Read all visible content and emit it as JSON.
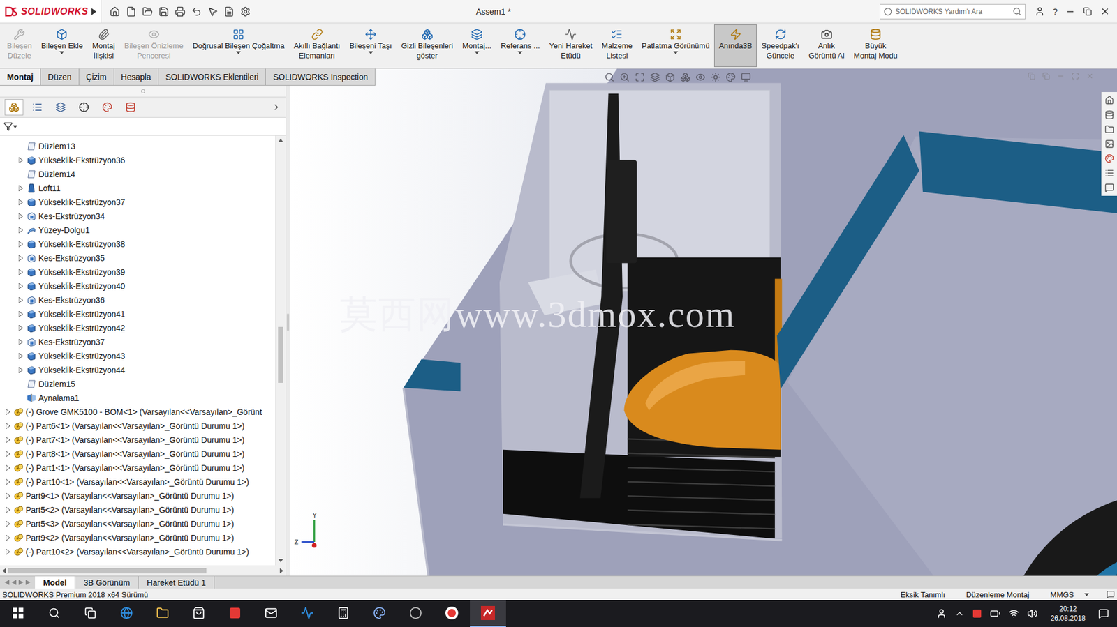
{
  "window": {
    "logo": "SOLIDWORKS",
    "title": "Assem1 *",
    "search_placeholder": "SOLIDWORKS Yardım'ı Ara",
    "help": "?"
  },
  "ribbon": [
    {
      "lines": [
        "Bileşen",
        "Düzele"
      ],
      "disabled": true,
      "pressed": false,
      "dropdown": false
    },
    {
      "lines": [
        "Bileşen Ekle"
      ],
      "disabled": false,
      "pressed": false,
      "dropdown": true
    },
    {
      "lines": [
        "Montaj",
        "İlişkisi"
      ],
      "disabled": false,
      "pressed": false,
      "dropdown": false
    },
    {
      "lines": [
        "Bileşen Önizleme",
        "Penceresi"
      ],
      "disabled": true,
      "pressed": false,
      "dropdown": false
    },
    {
      "lines": [
        "Doğrusal Bileşen Çoğaltma"
      ],
      "disabled": false,
      "pressed": false,
      "dropdown": true
    },
    {
      "lines": [
        "Akıllı Bağlantı",
        "Elemanları"
      ],
      "disabled": false,
      "pressed": false,
      "dropdown": false
    },
    {
      "lines": [
        "Bileşeni Taşı"
      ],
      "disabled": false,
      "pressed": false,
      "dropdown": true
    },
    {
      "lines": [
        "Gizli Bileşenleri",
        "göster"
      ],
      "disabled": false,
      "pressed": false,
      "dropdown": false
    },
    {
      "lines": [
        "Montaj..."
      ],
      "disabled": false,
      "pressed": false,
      "dropdown": true
    },
    {
      "lines": [
        "Referans ..."
      ],
      "disabled": false,
      "pressed": false,
      "dropdown": true
    },
    {
      "lines": [
        "Yeni Hareket",
        "Etüdü"
      ],
      "disabled": false,
      "pressed": false,
      "dropdown": false
    },
    {
      "lines": [
        "Malzeme",
        "Listesi"
      ],
      "disabled": false,
      "pressed": false,
      "dropdown": false
    },
    {
      "lines": [
        "Patlatma Görünümü"
      ],
      "disabled": false,
      "pressed": false,
      "dropdown": true
    },
    {
      "lines": [
        "Anında3B"
      ],
      "disabled": false,
      "pressed": true,
      "dropdown": false
    },
    {
      "lines": [
        "Speedpak'ı",
        "Güncele"
      ],
      "disabled": false,
      "pressed": false,
      "dropdown": false
    },
    {
      "lines": [
        "Anlık",
        "Görüntü Al"
      ],
      "disabled": false,
      "pressed": false,
      "dropdown": false
    },
    {
      "lines": [
        "Büyük",
        "Montaj Modu"
      ],
      "disabled": false,
      "pressed": false,
      "dropdown": false
    }
  ],
  "tabs": [
    {
      "label": "Montaj",
      "selected": true
    },
    {
      "label": "Düzen",
      "selected": false
    },
    {
      "label": "Çizim",
      "selected": false
    },
    {
      "label": "Hesapla",
      "selected": false
    },
    {
      "label": "SOLIDWORKS Eklentileri",
      "selected": false
    },
    {
      "label": "SOLIDWORKS Inspection",
      "selected": false
    }
  ],
  "feature_tree": {
    "vertical_scroll": {
      "level": 0.52
    },
    "horizontal_scroll": {
      "level": 0
    },
    "items": [
      {
        "label": "Düzlem13",
        "kind": "plane",
        "level": 1,
        "expandable": false
      },
      {
        "label": "Yükseklik-Ekstrüzyon36",
        "kind": "extrude",
        "level": 1,
        "expandable": true
      },
      {
        "label": "Düzlem14",
        "kind": "plane",
        "level": 1,
        "expandable": false
      },
      {
        "label": "Loft11",
        "kind": "loft",
        "level": 1,
        "expandable": true
      },
      {
        "label": "Yükseklik-Ekstrüzyon37",
        "kind": "extrude",
        "level": 1,
        "expandable": true
      },
      {
        "label": "Kes-Ekstrüzyon34",
        "kind": "cut",
        "level": 1,
        "expandable": true
      },
      {
        "label": "Yüzey-Dolgu1",
        "kind": "surface",
        "level": 1,
        "expandable": true
      },
      {
        "label": "Yükseklik-Ekstrüzyon38",
        "kind": "extrude",
        "level": 1,
        "expandable": true
      },
      {
        "label": "Kes-Ekstrüzyon35",
        "kind": "cut",
        "level": 1,
        "expandable": true
      },
      {
        "label": "Yükseklik-Ekstrüzyon39",
        "kind": "extrude",
        "level": 1,
        "expandable": true
      },
      {
        "label": "Yükseklik-Ekstrüzyon40",
        "kind": "extrude",
        "level": 1,
        "expandable": true
      },
      {
        "label": "Kes-Ekstrüzyon36",
        "kind": "cut",
        "level": 1,
        "expandable": true
      },
      {
        "label": "Yükseklik-Ekstrüzyon41",
        "kind": "extrude",
        "level": 1,
        "expandable": true
      },
      {
        "label": "Yükseklik-Ekstrüzyon42",
        "kind": "extrude",
        "level": 1,
        "expandable": true
      },
      {
        "label": "Kes-Ekstrüzyon37",
        "kind": "cut",
        "level": 1,
        "expandable": true
      },
      {
        "label": "Yükseklik-Ekstrüzyon43",
        "kind": "extrude",
        "level": 1,
        "expandable": true
      },
      {
        "label": "Yükseklik-Ekstrüzyon44",
        "kind": "extrude",
        "level": 1,
        "expandable": true
      },
      {
        "label": "Düzlem15",
        "kind": "plane",
        "level": 1,
        "expandable": false
      },
      {
        "label": "Aynalama1",
        "kind": "mirror",
        "level": 1,
        "expandable": false
      },
      {
        "label": "(-) Grove GMK5100 - BOM<1> (Varsayılan<<Varsayılan>_Görünt",
        "kind": "component",
        "level": 0,
        "expandable": true
      },
      {
        "label": "(-) Part6<1> (Varsayılan<<Varsayılan>_Görüntü Durumu 1>)",
        "kind": "component",
        "level": 0,
        "expandable": true
      },
      {
        "label": "(-) Part7<1> (Varsayılan<<Varsayılan>_Görüntü Durumu 1>)",
        "kind": "component",
        "level": 0,
        "expandable": true
      },
      {
        "label": "(-) Part8<1> (Varsayılan<<Varsayılan>_Görüntü Durumu 1>)",
        "kind": "component",
        "level": 0,
        "expandable": true
      },
      {
        "label": "(-) Part1<1> (Varsayılan<<Varsayılan>_Görüntü Durumu 1>)",
        "kind": "component",
        "level": 0,
        "expandable": true
      },
      {
        "label": "(-) Part10<1> (Varsayılan<<Varsayılan>_Görüntü Durumu 1>)",
        "kind": "component",
        "level": 0,
        "expandable": true
      },
      {
        "label": "Part9<1> (Varsayılan<<Varsayılan>_Görüntü Durumu 1>)",
        "kind": "component",
        "level": 0,
        "expandable": true
      },
      {
        "label": "Part5<2> (Varsayılan<<Varsayılan>_Görüntü Durumu 1>)",
        "kind": "component",
        "level": 0,
        "expandable": true
      },
      {
        "label": "Part5<3> (Varsayılan<<Varsayılan>_Görüntü Durumu 1>)",
        "kind": "component",
        "level": 0,
        "expandable": true
      },
      {
        "label": "Part9<2> (Varsayılan<<Varsayılan>_Görüntü Durumu 1>)",
        "kind": "component",
        "level": 0,
        "expandable": true
      },
      {
        "label": "(-) Part10<2> (Varsayılan<<Varsayılan>_Görüntü Durumu 1>)",
        "kind": "component",
        "level": 0,
        "expandable": true
      }
    ]
  },
  "viewport": {
    "watermark": "莫西网www.3dmox.com",
    "axes": [
      "Y",
      "Z"
    ]
  },
  "bottom_tabs": [
    {
      "label": "Model",
      "selected": true
    },
    {
      "label": "3B Görünüm",
      "selected": false
    },
    {
      "label": "Hareket Etüdü 1",
      "selected": false
    }
  ],
  "status_bar": {
    "version": "SOLIDWORKS Premium 2018 x64 Sürümü",
    "items": [
      "Eksik Tanımlı",
      "Düzenleme Montaj",
      "MMGS"
    ]
  },
  "taskbar": {
    "time": "20:12",
    "date": "26.08.2018"
  }
}
